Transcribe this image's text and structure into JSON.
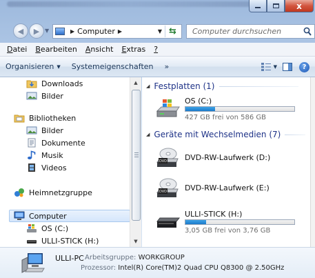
{
  "window": {
    "caption_minimize": "",
    "caption_maximize": "",
    "caption_close": "x"
  },
  "address": {
    "crumb": "Computer",
    "search_placeholder": "Computer durchsuchen"
  },
  "menu": [
    {
      "label": "Datei"
    },
    {
      "label": "Bearbeiten"
    },
    {
      "label": "Ansicht"
    },
    {
      "label": "Extras"
    },
    {
      "label": "?"
    }
  ],
  "toolbar": {
    "organize": "Organisieren",
    "properties": "Systemeigenschaften",
    "more": "»"
  },
  "nav": {
    "downloads": "Downloads",
    "bilder_fav": "Bilder",
    "bibliotheken": "Bibliotheken",
    "bilder": "Bilder",
    "dokumente": "Dokumente",
    "musik": "Musik",
    "videos": "Videos",
    "heimnetz": "Heimnetzgruppe",
    "computer": "Computer",
    "os": "OS (C:)",
    "stick": "ULLI-STICK (H:)"
  },
  "content": {
    "group_hdd": "Festplatten (1)",
    "group_removable": "Geräte mit Wechselmedien (7)",
    "drives": [
      {
        "name": "OS (C:)",
        "free": "427 GB frei von 586 GB",
        "used_fraction": 0.27
      },
      {
        "name": "DVD-RW-Laufwerk (D:)"
      },
      {
        "name": "DVD-RW-Laufwerk (E:)"
      },
      {
        "name": "ULLI-STICK (H:)",
        "free": "3,05 GB frei von 3,76 GB",
        "used_fraction": 0.19
      }
    ]
  },
  "details": {
    "pc_name": "ULLI-PC",
    "workgroup_label": "Arbeitsgruppe:",
    "workgroup": "WORKGROUP",
    "processor_label": "Prozessor:",
    "processor": "Intel(R) Core(TM)2 Quad CPU    Q8300  @ 2.50GHz"
  },
  "colors": {
    "group_header": "#1e3287",
    "drive_bar": "#1c7ac9"
  }
}
